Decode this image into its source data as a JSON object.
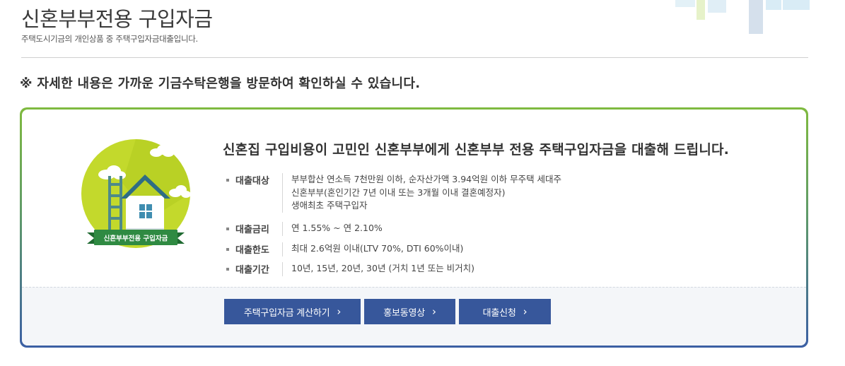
{
  "header": {
    "title": "신혼부부전용 구입자금",
    "subtitle": "주택도시기금의 개인상품 중 주택구입자금대출입니다."
  },
  "notice": "※ 자세한 내용은 가까운 기금수탁은행을 방문하여 확인하실 수 있습니다.",
  "product": {
    "emblem_label": "신혼부부전용 구입자금",
    "headline": "신혼집 구입비용이 고민인 신혼부부에게 신혼부부 전용 주택구입자금을 대출해 드립니다.",
    "details": [
      {
        "label": "대출대상",
        "lines": [
          "부부합산 연소득 7천만원 이하, 순자산가액 3.94억원 이하 무주택 세대주",
          "신혼부부(혼인기간 7년 이내 또는 3개월 이내 결혼예정자)",
          "생애최초 주택구입자"
        ]
      },
      {
        "label": "대출금리",
        "lines": [
          "연 1.55% ~ 연 2.10%"
        ]
      },
      {
        "label": "대출한도",
        "lines": [
          "최대 2.6억원 이내(LTV 70%, DTI 60%이내)"
        ]
      },
      {
        "label": "대출기간",
        "lines": [
          "10년, 15년, 20년, 30년 (거치 1년 또는 비거치)"
        ]
      }
    ]
  },
  "buttons": [
    {
      "label": "주택구입자금 계산하기",
      "icon": "chevron-right-icon"
    },
    {
      "label": "홍보동영상",
      "icon": "chevron-right-icon"
    },
    {
      "label": "대출신청",
      "icon": "chevron-right-icon"
    }
  ],
  "colors": {
    "button_bg": "#37579b",
    "card_border_top": "#7fba3f",
    "card_border_bottom": "#3b5fa4",
    "emblem_green": "#c3d92c",
    "emblem_ribbon": "#2f8a42"
  }
}
